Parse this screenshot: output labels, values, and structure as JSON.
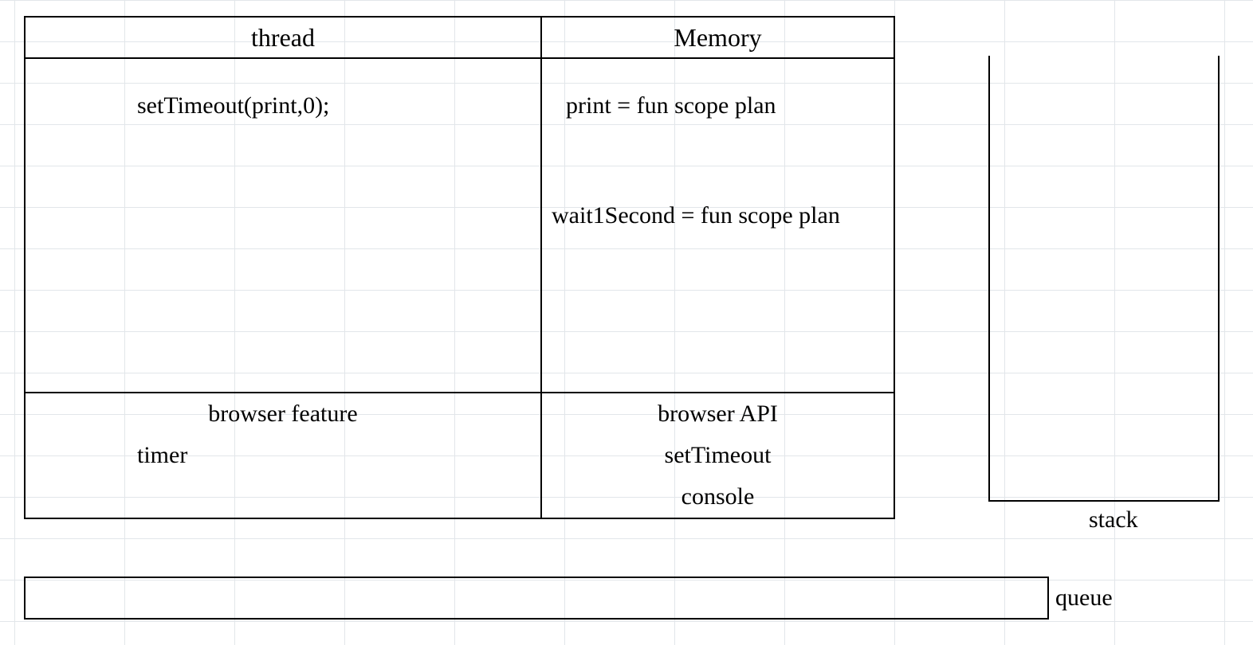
{
  "headers": {
    "thread": "thread",
    "memory": "Memory"
  },
  "thread_body": {
    "line1": "setTimeout(print,0);"
  },
  "memory_body": {
    "line1": "print = fun scope plan",
    "line2": "wait1Second = fun scope plan"
  },
  "footer": {
    "browser_feature": "browser feature",
    "browser_api": "browser API",
    "timer": "timer",
    "setTimeout": "setTimeout",
    "console": "console"
  },
  "stack": {
    "label": "stack"
  },
  "queue": {
    "label": "queue"
  }
}
